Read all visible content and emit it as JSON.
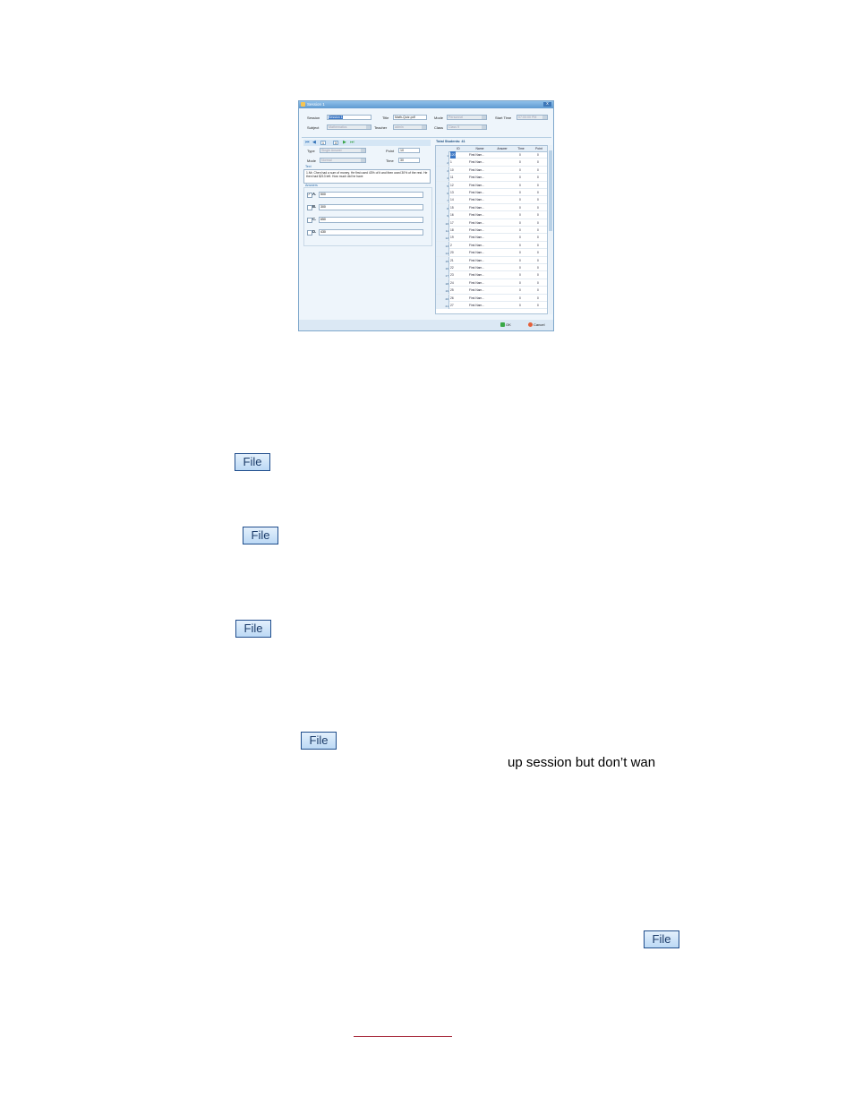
{
  "dialog": {
    "title": "Session 1",
    "close_label": "x",
    "header": {
      "session_label": "Session",
      "session_value": "Session 1",
      "subject_label": "Subject",
      "subject_value": "Mathematics",
      "title_label": "Title",
      "title_value": "Math-Quiz.pdf",
      "teacher_label": "Teacher",
      "teacher_value": "admin",
      "mode_label": "Mode",
      "mode_value": "Personnel",
      "class_label": "Class",
      "class_value": "Class 9",
      "start_time_label": "Start Time",
      "start_time_value": "07:00:00 PM"
    },
    "nav": {
      "page_value": "1",
      "total_value": "3"
    },
    "question": {
      "type_label": "Type",
      "type_value": "Single Answer",
      "mode_label": "Mode",
      "mode_value": "Normal",
      "point_label": "Point",
      "point_value": "10",
      "time_label": "Time",
      "time_value": "30",
      "text_section": "Text",
      "text": "1.Mr. Chen had a sum of money. He first used 43% of it and then used 30% of the rest. He then had $213 left. How much did he have",
      "answers_section": "Answers",
      "answers": [
        {
          "letter": "A.",
          "value": "500",
          "checked": true
        },
        {
          "letter": "B.",
          "value": "300",
          "checked": false
        },
        {
          "letter": "C.",
          "value": "650",
          "checked": false
        },
        {
          "letter": "D.",
          "value": "430",
          "checked": false
        }
      ]
    },
    "students": {
      "total_label": "Total Students: 41",
      "columns": [
        "ID",
        "Name",
        "Answer",
        "Time",
        "Point"
      ],
      "rows": [
        {
          "rn": "1",
          "id": "120",
          "name": "First Nam...",
          "answer": "",
          "time": "0",
          "point": "0"
        },
        {
          "rn": "2",
          "id": "1",
          "name": "First Nam...",
          "answer": "",
          "time": "0",
          "point": "0"
        },
        {
          "rn": "3",
          "id": "10",
          "name": "First Nam...",
          "answer": "",
          "time": "0",
          "point": "0"
        },
        {
          "rn": "4",
          "id": "11",
          "name": "First Nam...",
          "answer": "",
          "time": "0",
          "point": "0"
        },
        {
          "rn": "5",
          "id": "12",
          "name": "First Nam...",
          "answer": "",
          "time": "0",
          "point": "0"
        },
        {
          "rn": "6",
          "id": "13",
          "name": "First Nam...",
          "answer": "",
          "time": "0",
          "point": "0"
        },
        {
          "rn": "7",
          "id": "14",
          "name": "First Nam...",
          "answer": "",
          "time": "0",
          "point": "0"
        },
        {
          "rn": "8",
          "id": "15",
          "name": "First Nam...",
          "answer": "",
          "time": "0",
          "point": "0"
        },
        {
          "rn": "9",
          "id": "16",
          "name": "First Nam...",
          "answer": "",
          "time": "0",
          "point": "0"
        },
        {
          "rn": "10",
          "id": "17",
          "name": "First Nam...",
          "answer": "",
          "time": "0",
          "point": "0"
        },
        {
          "rn": "11",
          "id": "18",
          "name": "First Nam...",
          "answer": "",
          "time": "0",
          "point": "0"
        },
        {
          "rn": "12",
          "id": "19",
          "name": "First Nam...",
          "answer": "",
          "time": "0",
          "point": "0"
        },
        {
          "rn": "13",
          "id": "2",
          "name": "First Nam...",
          "answer": "",
          "time": "0",
          "point": "0"
        },
        {
          "rn": "14",
          "id": "20",
          "name": "First Nam...",
          "answer": "",
          "time": "0",
          "point": "0"
        },
        {
          "rn": "15",
          "id": "21",
          "name": "First Nam...",
          "answer": "",
          "time": "0",
          "point": "0"
        },
        {
          "rn": "16",
          "id": "22",
          "name": "First Nam...",
          "answer": "",
          "time": "0",
          "point": "0"
        },
        {
          "rn": "17",
          "id": "23",
          "name": "First Nam...",
          "answer": "",
          "time": "0",
          "point": "0"
        },
        {
          "rn": "18",
          "id": "24",
          "name": "First Nam...",
          "answer": "",
          "time": "0",
          "point": "0"
        },
        {
          "rn": "19",
          "id": "25",
          "name": "First Nam...",
          "answer": "",
          "time": "0",
          "point": "0"
        },
        {
          "rn": "20",
          "id": "26",
          "name": "First Nam...",
          "answer": "",
          "time": "0",
          "point": "0"
        },
        {
          "rn": "21",
          "id": "27",
          "name": "First Nam...",
          "answer": "",
          "time": "0",
          "point": "0"
        }
      ]
    },
    "footer": {
      "ok_label": "OK",
      "cancel_label": "Cancel"
    }
  },
  "page": {
    "file_label": "File",
    "snippet_text": "up session but don’t wan"
  },
  "colors": {
    "accent": "#3a76c4",
    "link": "#a11a2d"
  }
}
